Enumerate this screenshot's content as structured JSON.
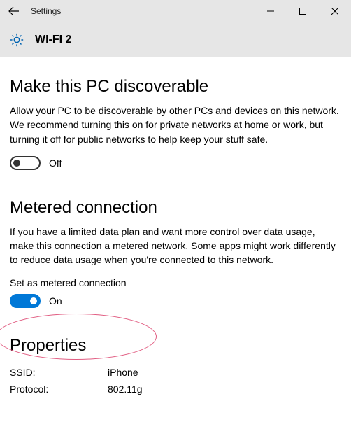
{
  "titlebar": {
    "title": "Settings"
  },
  "subheader": {
    "network_name": "WI-FI 2"
  },
  "discoverable": {
    "heading": "Make this PC discoverable",
    "description": "Allow your PC to be discoverable by other PCs and devices on this network. We recommend turning this on for private networks at home or work, but turning it off for public networks to help keep your stuff safe.",
    "state_label": "Off",
    "value": false
  },
  "metered": {
    "heading": "Metered connection",
    "description": "If you have a limited data plan and want more control over data usage, make this connection a metered network. Some apps might work differently to reduce data usage when you're connected to this network.",
    "sublabel": "Set as metered connection",
    "state_label": "On",
    "value": true
  },
  "properties": {
    "heading": "Properties",
    "rows": [
      {
        "key": "SSID:",
        "val": "iPhone"
      },
      {
        "key": "Protocol:",
        "val": "802.11g"
      }
    ]
  }
}
